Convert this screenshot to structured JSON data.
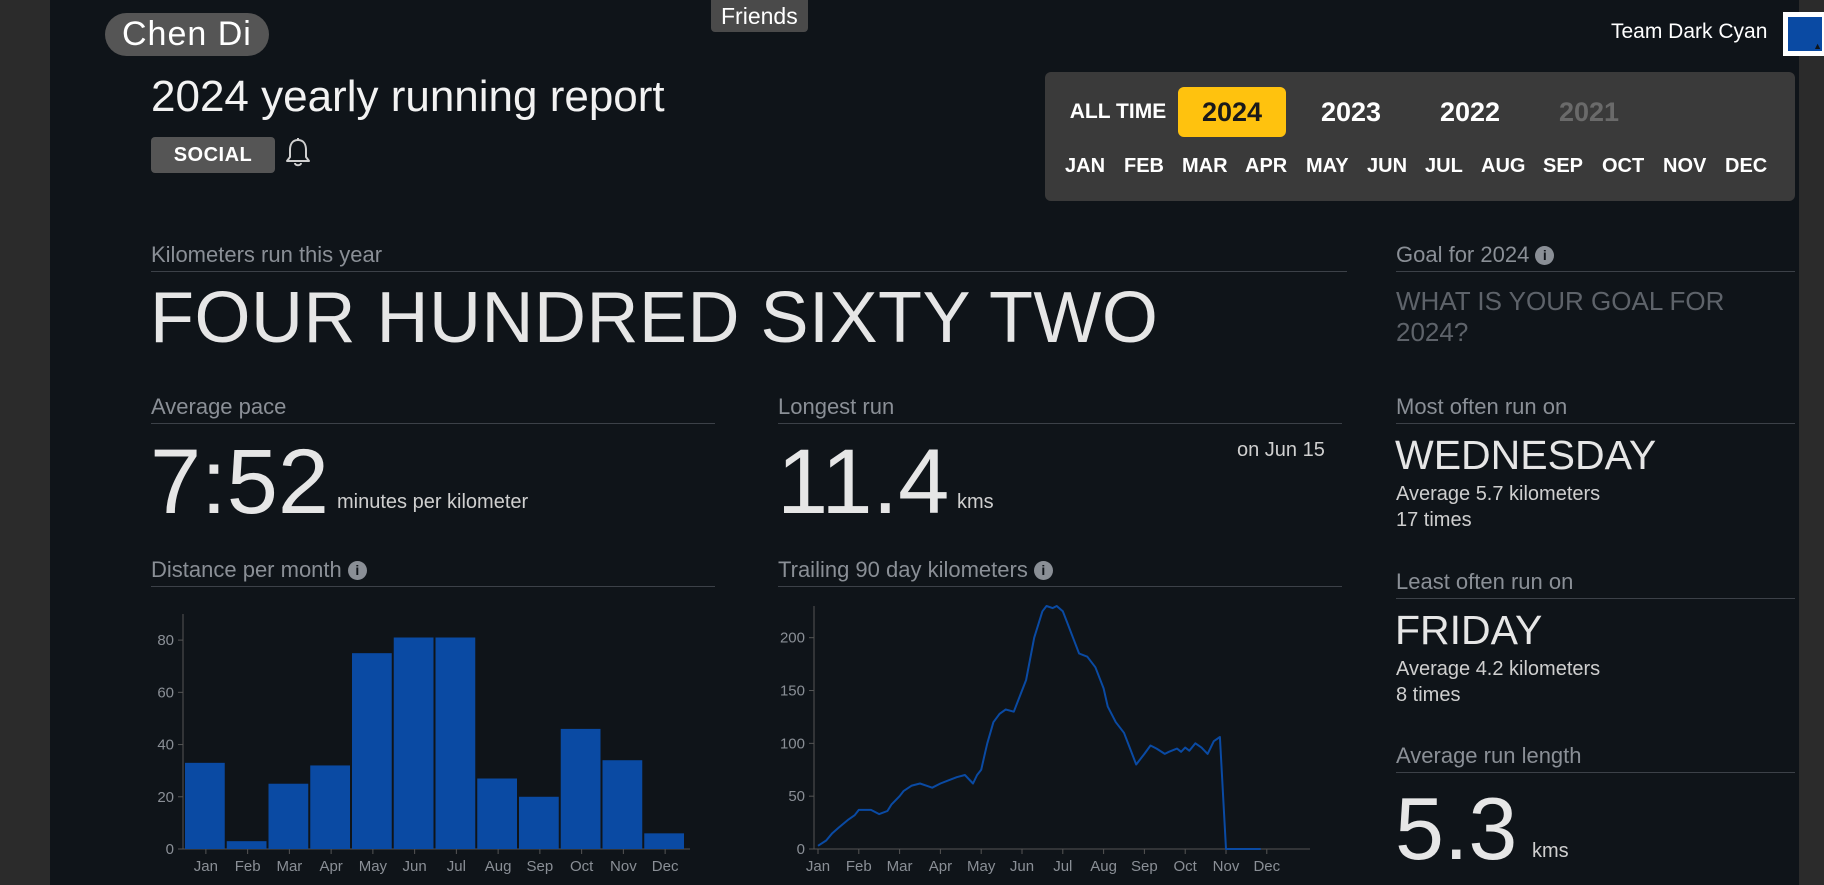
{
  "header": {
    "user_name": "Chen Di",
    "friends_label": "Friends",
    "team_name": "Team Dark Cyan",
    "team_color": "#0a4aa3"
  },
  "report": {
    "title": "2024 yearly running report",
    "social_label": "SOCIAL",
    "bell_icon": "bell-icon"
  },
  "period": {
    "all_time_label": "ALL TIME",
    "years": [
      {
        "label": "2024",
        "state": "selected"
      },
      {
        "label": "2023",
        "state": "normal"
      },
      {
        "label": "2022",
        "state": "normal"
      },
      {
        "label": "2021",
        "state": "disabled"
      }
    ],
    "months": [
      "JAN",
      "FEB",
      "MAR",
      "APR",
      "MAY",
      "JUN",
      "JUL",
      "AUG",
      "SEP",
      "OCT",
      "NOV",
      "DEC"
    ],
    "selected_color": "#ffc20e"
  },
  "stats": {
    "km_label": "Kilometers run this year",
    "km_words": "FOUR HUNDRED SIXTY TWO",
    "pace_label": "Average pace",
    "pace_value": "7:52",
    "pace_unit": "minutes per kilometer",
    "longest_label": "Longest run",
    "longest_value": "11.4",
    "longest_unit": "kms",
    "longest_date": "on Jun 15",
    "goal_label": "Goal for 2024",
    "goal_prompt": "WHAT IS YOUR GOAL FOR 2024?",
    "most_label": "Most often run on",
    "most_day": "WEDNESDAY",
    "most_avg": "Average 5.7 kilometers",
    "most_times": "17 times",
    "least_label": "Least often run on",
    "least_day": "FRIDAY",
    "least_avg": "Average 4.2 kilometers",
    "least_times": "8 times",
    "avg_len_label": "Average run length",
    "avg_len_value": "5.3",
    "avg_len_unit": "kms",
    "dist_month_label": "Distance per month",
    "trailing_label": "Trailing 90 day kilometers"
  },
  "chart_data": [
    {
      "type": "bar",
      "categories": [
        "Jan",
        "Feb",
        "Mar",
        "Apr",
        "May",
        "Jun",
        "Jul",
        "Aug",
        "Sep",
        "Oct",
        "Nov",
        "Dec"
      ],
      "values": [
        33,
        3,
        25,
        32,
        75,
        81,
        81,
        27,
        20,
        46,
        34,
        6
      ],
      "ylim": [
        0,
        90
      ],
      "yticks": [
        0,
        20,
        40,
        60,
        80
      ],
      "color": "#0a4aa3",
      "grid": false
    },
    {
      "type": "line",
      "x_months": [
        "Jan",
        "Feb",
        "Mar",
        "Apr",
        "May",
        "Jun",
        "Jul",
        "Aug",
        "Sep",
        "Oct",
        "Nov",
        "Dec"
      ],
      "x": [
        0,
        0.2,
        0.35,
        0.5,
        0.75,
        0.9,
        1.0,
        1.1,
        1.3,
        1.5,
        1.7,
        1.8,
        2.0,
        2.1,
        2.3,
        2.5,
        2.65,
        2.8,
        3.0,
        3.2,
        3.4,
        3.6,
        3.8,
        3.9,
        4.0,
        4.1,
        4.15,
        4.3,
        4.45,
        4.6,
        4.8,
        4.9,
        5.1,
        5.3,
        5.5,
        5.6,
        5.75,
        5.85,
        6.0,
        6.1,
        6.25,
        6.4,
        6.6,
        6.8,
        7.0,
        7.1,
        7.3,
        7.5,
        7.65,
        7.8,
        8.0,
        8.15,
        8.3,
        8.5,
        8.6,
        8.8,
        8.9,
        9.0,
        9.1,
        9.25,
        9.4,
        9.55,
        9.7,
        9.85,
        10.0,
        10.15,
        10.3,
        10.5,
        10.7,
        10.85,
        11.0
      ],
      "y": [
        3,
        8,
        15,
        20,
        28,
        32,
        37,
        37,
        37,
        33,
        36,
        42,
        50,
        55,
        60,
        62,
        60,
        58,
        62,
        65,
        68,
        70,
        62,
        70,
        75,
        92,
        100,
        120,
        128,
        132,
        130,
        140,
        160,
        200,
        225,
        230,
        228,
        230,
        225,
        215,
        200,
        185,
        182,
        172,
        152,
        135,
        120,
        110,
        95,
        80,
        90,
        98,
        95,
        90,
        92,
        95,
        92,
        96,
        93,
        100,
        96,
        90,
        102,
        106,
        0,
        0,
        0,
        0,
        0,
        0,
        0
      ],
      "ylim": [
        0,
        230
      ],
      "yticks": [
        0,
        50,
        100,
        150,
        200
      ],
      "color": "#0a4aa3"
    }
  ]
}
